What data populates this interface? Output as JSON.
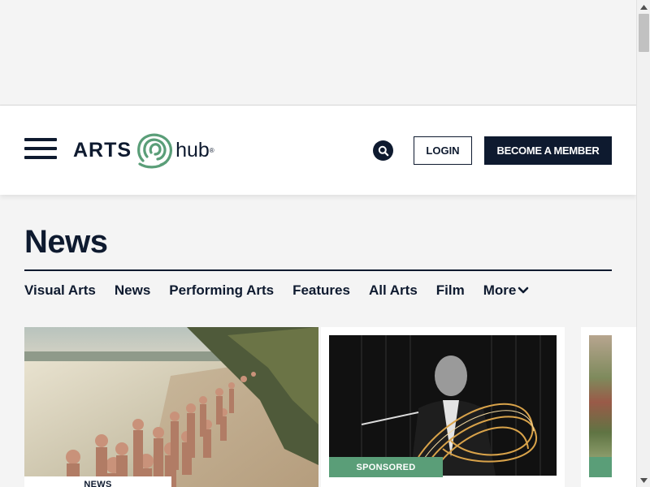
{
  "header": {
    "logo_text_left": "ARTS",
    "logo_text_right": "hub",
    "logo_reg": "®",
    "login_label": "LOGIN",
    "member_label": "BECOME A MEMBER"
  },
  "page": {
    "title": "News"
  },
  "subnav": {
    "items": [
      "Visual Arts",
      "News",
      "Performing Arts",
      "Features",
      "All Arts",
      "Film"
    ],
    "more_label": "More"
  },
  "cards": [
    {
      "tag": "NEWS"
    },
    {
      "tag": "SPONSORED"
    }
  ],
  "colors": {
    "navy": "#0e1a2f",
    "green": "#5a9e78",
    "background": "#f4f4f4"
  },
  "icons": {
    "menu": "hamburger-menu-icon",
    "search": "search-icon",
    "more": "chevron-down-icon"
  }
}
